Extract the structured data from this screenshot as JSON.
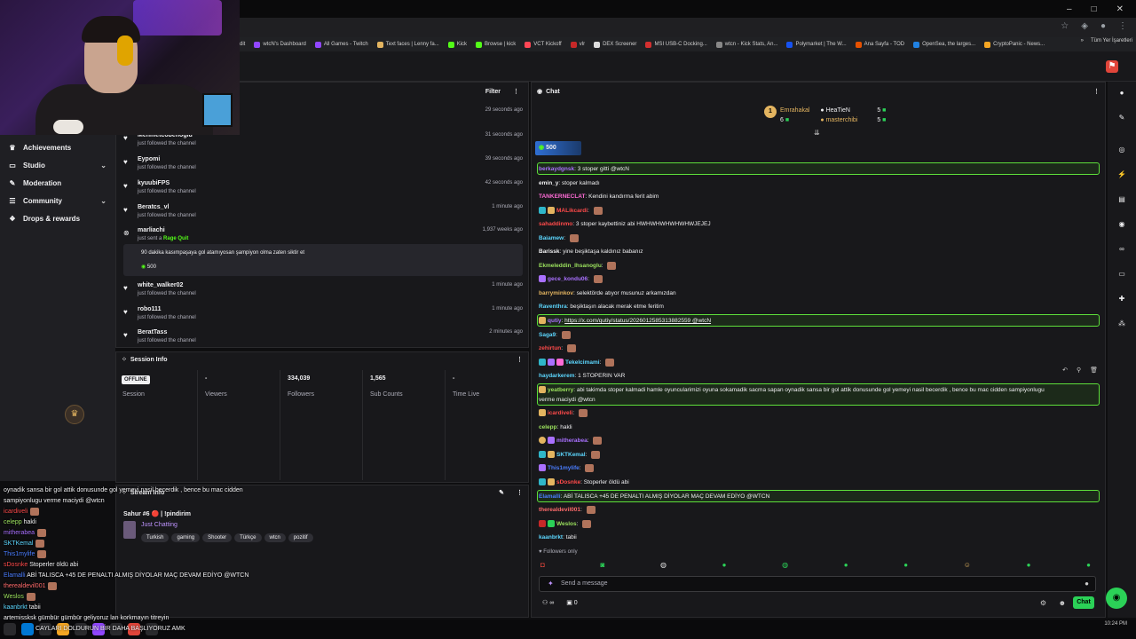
{
  "window": {
    "controls": [
      "–",
      "□",
      "✕"
    ]
  },
  "bookmarks": [
    "dit",
    "wtcN's Dashboard",
    "All Games - Twitch",
    "Text faces | Lenny fa...",
    "Kick",
    "Browse | kick",
    "VCT Kickoff",
    "vlr",
    "DEX Screener",
    "MSI USB-C Docking...",
    "wtcn - Kick Stats, An...",
    "Polymarket | The W...",
    "Ana Sayfa - TOD",
    "OpenSea, the larges...",
    "CryptoPanic - News..."
  ],
  "bookmarks_right": [
    "»",
    "Tüm Yer İşaretleri"
  ],
  "leftnav": {
    "items": [
      {
        "label": "Achievements",
        "icon": "trophy-icon",
        "chev": ""
      },
      {
        "label": "Studio",
        "icon": "tv-icon",
        "chev": "⌄"
      },
      {
        "label": "Moderation",
        "icon": "wrench-icon",
        "chev": ""
      },
      {
        "label": "Community",
        "icon": "list-icon",
        "chev": "⌄"
      },
      {
        "label": "Drops & rewards",
        "icon": "gift-icon",
        "chev": ""
      }
    ]
  },
  "overlay": {
    "lines": [
      {
        "name": "",
        "text": "oynadik sansa bir gol attik donusunde gol yemeyi nasil becerdik , bence bu mac cidden",
        "color": "#efeff1"
      },
      {
        "name": "",
        "text": "sampiyonlugu verme maciydi @wtcn",
        "color": "#efeff1"
      },
      {
        "name": "icardiveli",
        "text": "",
        "color": "#ff4a4a"
      },
      {
        "name": "celepp",
        "text": "hakli",
        "color": "#9be15d"
      },
      {
        "name": "mitherabea",
        "text": "",
        "color": "#a970ff"
      },
      {
        "name": "SKTKemal",
        "text": "",
        "color": "#5cd7ff"
      },
      {
        "name": "This1mylife",
        "text": "",
        "color": "#4a7dff"
      },
      {
        "name": "sDosnke",
        "text": "Stoperler öldü abi",
        "color": "#ff4a4a"
      },
      {
        "name": "Elamalli",
        "text": "ABİ TALISCA +45 DE PENALTI ALMIŞ DİYOLAR MAÇ DEVAM EDİYO @WTCN",
        "color": "#4a7dff"
      },
      {
        "name": "therealdevil001",
        "text": "",
        "color": "#ff6b6b"
      },
      {
        "name": "Weslos",
        "text": "",
        "color": "#9be15d"
      },
      {
        "name": "kaanbrkt",
        "text": "tabii",
        "color": "#5cd7ff"
      },
      {
        "name": "artemissksk",
        "text": "gümbür gümbür geliyoruz lan korkmayın titreyin",
        "color": "#efeff1"
      },
      {
        "name": "",
        "text": "CAYLARI DOLDURUN BİR DAHA BAŞLIYORUZ AMK",
        "color": "#efeff1"
      }
    ]
  },
  "feed": {
    "filter": "Filter",
    "menu": "⋮",
    "items": [
      {
        "name": "",
        "sub": "",
        "time": "29 seconds ago",
        "icon": "heart-icon"
      },
      {
        "name": "Mehmetcobenoglu",
        "sub": "just followed the channel",
        "time": "31 seconds ago",
        "icon": "heart-icon"
      },
      {
        "name": "Eypomi",
        "sub": "just followed the channel",
        "time": "39 seconds ago",
        "icon": "heart-icon"
      },
      {
        "name": "kyuubiFPS",
        "sub": "just followed the channel",
        "time": "42 seconds ago",
        "icon": "heart-icon"
      },
      {
        "name": "Beratcs_vl",
        "sub": "just followed the channel",
        "time": "1 minute ago",
        "icon": "heart-icon"
      },
      {
        "name": "marliachi",
        "sub": "just sent a",
        "sub_link": "Rage Quit",
        "time": "1,937 weeks ago",
        "icon": "kick-icon"
      },
      {
        "name": "white_walker02",
        "sub": "just followed the channel",
        "time": "1 minute ago",
        "icon": "heart-icon"
      },
      {
        "name": "robo111",
        "sub": "just followed the channel",
        "time": "1 minute ago",
        "icon": "heart-icon"
      },
      {
        "name": "BeratTass",
        "sub": "just followed the channel",
        "time": "2 minutes ago",
        "icon": "heart-icon"
      }
    ],
    "ragequit": {
      "message": "90 dakika kasımpaşaya gol atamıyosan şampiyon olma zaten siktir et",
      "amount": "500"
    }
  },
  "session": {
    "title": "Session Info",
    "status": "OFFLINE",
    "cols": [
      {
        "value": "",
        "label": "Session"
      },
      {
        "value": "-",
        "label": "Viewers"
      },
      {
        "value": "334,039",
        "label": "Followers"
      },
      {
        "value": "1,565",
        "label": "Sub Counts"
      },
      {
        "value": "-",
        "label": "Time Live"
      }
    ]
  },
  "streaminfo": {
    "title": "Stream Info",
    "stream_title": "Sahur #6 🔴 | !pindirim",
    "category": "Just Chatting",
    "tags": [
      "Turkish",
      "gaming",
      "Shooter",
      "Türkçe",
      "wtcn",
      "pozitif"
    ]
  },
  "chat": {
    "title": "Chat",
    "leaderboard": {
      "rank": "1",
      "user1": "Emrahakal",
      "count1": "6",
      "user2": "HeaTieN",
      "count2": "5",
      "user3": "masterchibi",
      "count3": "5"
    },
    "pinned_amount": "500",
    "messages": [
      {
        "name": "berkaydgnsk",
        "text": "3 stoper gitti @wtcN",
        "color": "#a970ff",
        "hl": true
      },
      {
        "name": "emin_y",
        "text": "stoper kalmadı",
        "color": "#efeff1"
      },
      {
        "name": "TANKERNECLAT",
        "text": "Kendini kandırma ferit abim",
        "color": "#ff6bd6"
      },
      {
        "name": "MALikcardi",
        "text": "",
        "color": "#ff4a4a"
      },
      {
        "name": "sahaddinmo",
        "text": "3 stoper kaybettiniz abi HWHWHWHWHWHWJEJEJ",
        "color": "#ff4a4a"
      },
      {
        "name": "Baiamew",
        "text": "",
        "color": "#5cd7ff"
      },
      {
        "name": "Barissk",
        "text": "yine beşiktaşa kaldınız babanız",
        "color": "#efeff1"
      },
      {
        "name": "Ekmeleddin_Ihsanoglu",
        "text": "",
        "color": "#9be15d"
      },
      {
        "name": "gece_kondu06",
        "text": "",
        "color": "#a970ff"
      },
      {
        "name": "barryminkov",
        "text": "selektörde atıyor musunuz arkamızdan",
        "color": "#e3b460"
      },
      {
        "name": "Raventhra",
        "text": "beşiktaşın alacak merak etme feritim",
        "color": "#5cd7ff"
      },
      {
        "name": "qutiy",
        "text": "https://x.com/qutiy/status/2026012585313882559 @wtcN",
        "color": "#a970ff",
        "hl": true
      },
      {
        "name": "Saga9",
        "text": "",
        "color": "#5cd7ff"
      },
      {
        "name": "zehirtun",
        "text": "",
        "color": "#ff4a4a"
      },
      {
        "name": "Tekelcimami",
        "text": "",
        "color": "#5cd7ff"
      },
      {
        "name": "haydarkerem",
        "text": "1 STOPERIN VAR",
        "color": "#5cd7ff"
      },
      {
        "name": "yeatberry",
        "text": "abi takimda stoper kalmadi hamle oyuncularimizi oyuna sokamadik sacma sapan oynadik sansa bir gol attik donusunde gol yemeyi nasil becerdik , bence bu mac cidden sampiyonlugu",
        "text2": "verme maciydi @wtcn",
        "color": "#9be15d",
        "hl": true
      },
      {
        "name": "icardiveli",
        "text": "",
        "color": "#ff4a4a"
      },
      {
        "name": "celepp",
        "text": "hakli",
        "color": "#9be15d"
      },
      {
        "name": "mitherabea",
        "text": "",
        "color": "#a970ff"
      },
      {
        "name": "SKTKemal",
        "text": "",
        "color": "#5cd7ff"
      },
      {
        "name": "This1mylife",
        "text": "",
        "color": "#4a7dff"
      },
      {
        "name": "sDosnke",
        "text": "Stoperler öldü abi",
        "color": "#ff4a4a"
      },
      {
        "name": "Elamalli",
        "text": "ABİ TALISCA +45 DE PENALTI ALMIŞ DİYOLAR MAÇ DEVAM EDİYO @WTCN",
        "color": "#4a7dff",
        "hl": true
      },
      {
        "name": "therealdevil001",
        "text": "",
        "color": "#ff6b6b"
      },
      {
        "name": "Weslos",
        "text": "",
        "color": "#9be15d"
      },
      {
        "name": "kaanbrkt",
        "text": "tabii",
        "color": "#5cd7ff"
      }
    ],
    "followers_only": "Followers only",
    "input_placeholder": "Send a message",
    "viewers": "0",
    "send_label": "Chat"
  },
  "clock": "10:24 PM"
}
